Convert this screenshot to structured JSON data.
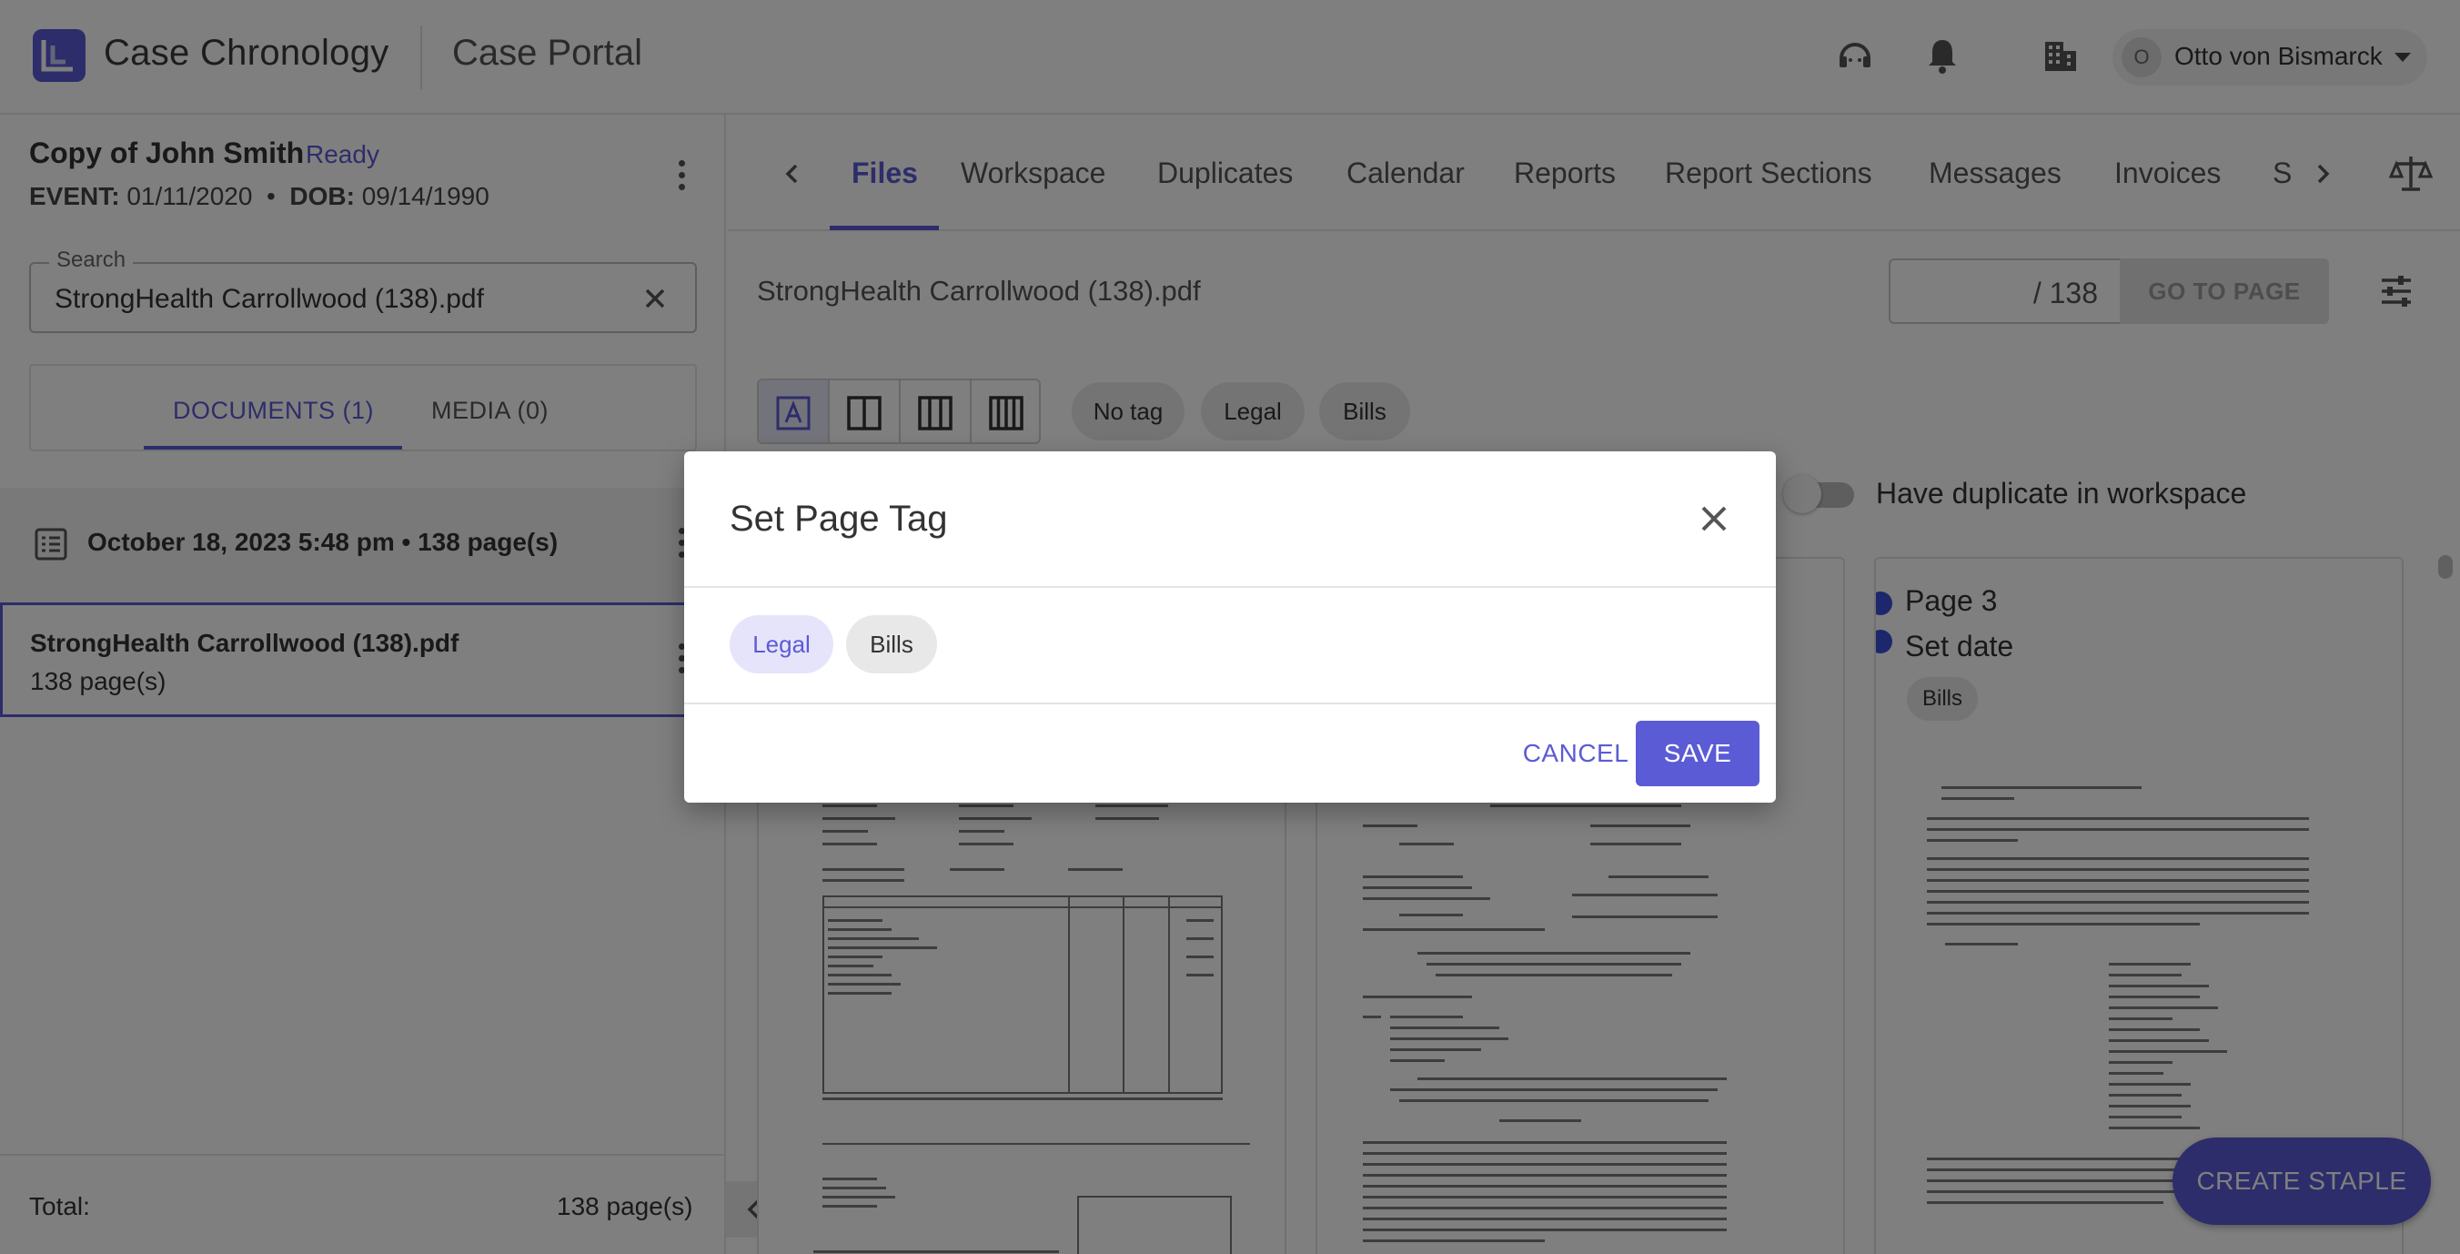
{
  "header": {
    "app_title": "Case Chronology",
    "portal_title": "Case Portal",
    "user_initial": "O",
    "user_name": "Otto von Bismarck"
  },
  "case": {
    "name": "Copy of John Smith",
    "status": "Ready",
    "event_label": "EVENT:",
    "event_date": "01/11/2020",
    "dob_label": "DOB:",
    "dob_date": "09/14/1990"
  },
  "search": {
    "label": "Search",
    "value": "StrongHealth Carrollwood (138).pdf"
  },
  "doc_tabs": {
    "documents": "DOCUMENTS (1)",
    "media": "MEDIA (0)"
  },
  "group": {
    "label": "October 18, 2023 5:48 pm  •  138 page(s)"
  },
  "file": {
    "name": "StrongHealth Carrollwood (138).pdf",
    "pages": "138 page(s)"
  },
  "total": {
    "label": "Total:",
    "value": "138 page(s)"
  },
  "nav_tabs": [
    "Files",
    "Workspace",
    "Duplicates",
    "Calendar",
    "Reports",
    "Report Sections",
    "Messages",
    "Invoices",
    "S"
  ],
  "viewer": {
    "file_title": "StrongHealth Carrollwood (138).pdf",
    "page_total": "/ 138",
    "goto_label": "GO TO PAGE",
    "filter_chips": [
      "No tag",
      "Legal",
      "Bills"
    ],
    "toggle_label": "Have duplicate in workspace",
    "toggle_on": false
  },
  "card3": {
    "page_label": "Page 3",
    "date_label": "Set date",
    "tag": "Bills"
  },
  "fab_label": "CREATE STAPLE",
  "dialog": {
    "title": "Set Page Tag",
    "tags": [
      "Legal",
      "Bills"
    ],
    "selected_tag": "Legal",
    "cancel_label": "CANCEL",
    "save_label": "SAVE"
  },
  "colors": {
    "accent": "#5b5bd6",
    "overlay": "rgba(0,0,0,0.5)"
  }
}
